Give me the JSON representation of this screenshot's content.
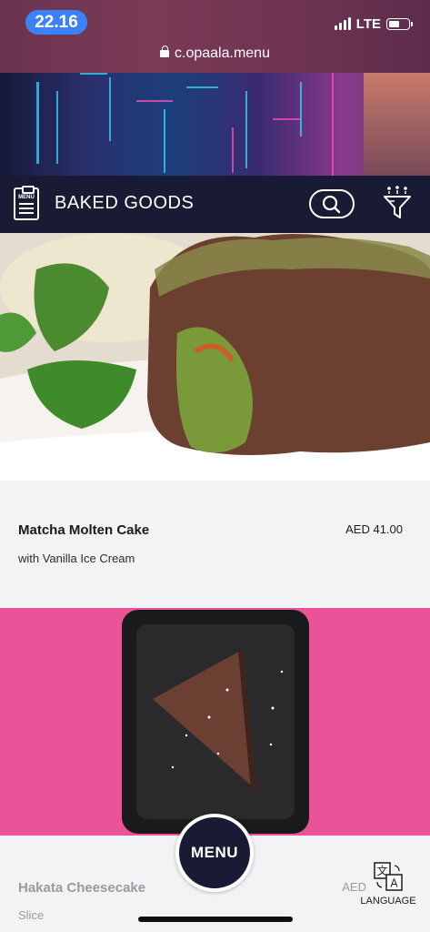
{
  "status_bar": {
    "time": "22.16",
    "network": "LTE",
    "battery_level": 0.6
  },
  "browser": {
    "url": "c.opaala.menu"
  },
  "nav": {
    "menu_icon_text": "MENU",
    "category_title": "BAKED GOODS"
  },
  "items": [
    {
      "name": "Matcha Molten Cake",
      "description": "with Vanilla Ice Cream",
      "price": "AED 41.00"
    },
    {
      "name": "Hakata Cheesecake",
      "description": "Slice",
      "price": "AED"
    }
  ],
  "floating": {
    "menu_button": "MENU",
    "language_label": "LANGUAGE",
    "language_glyphs": [
      "文",
      "A"
    ]
  },
  "colors": {
    "nav_bg": "#181b33",
    "time_pill": "#3a82f7",
    "item2_photo_bg": "#ec5297"
  }
}
